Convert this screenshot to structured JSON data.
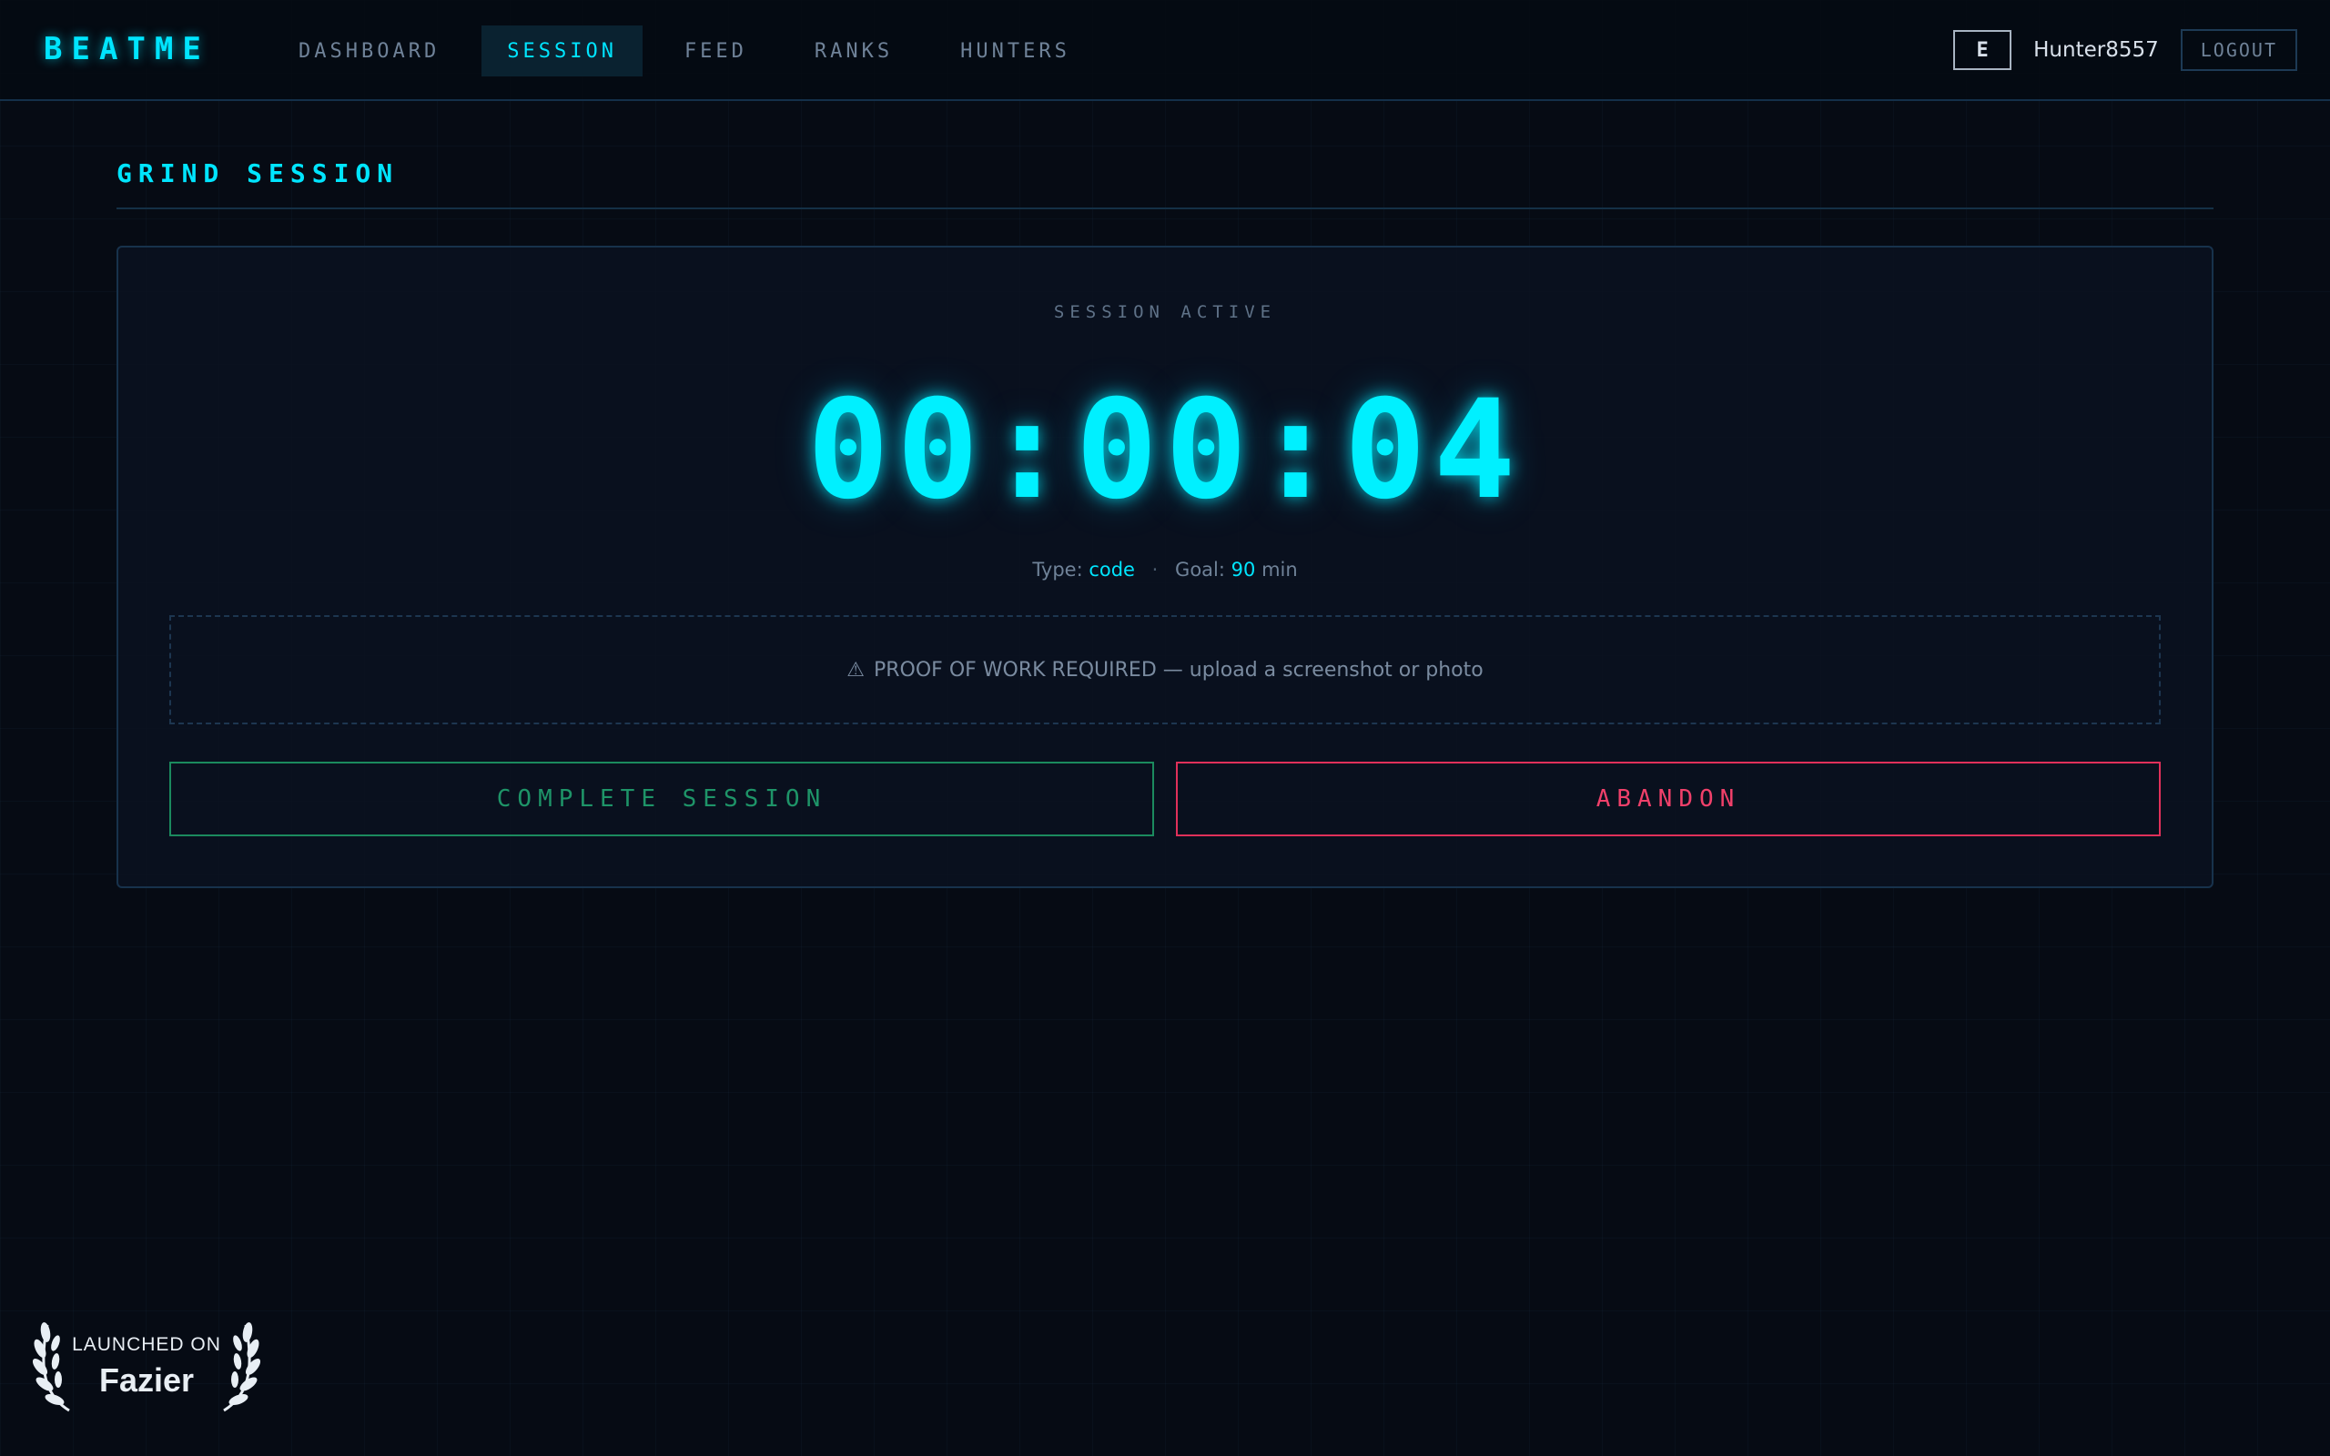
{
  "app": {
    "logo": "BEATME"
  },
  "nav": {
    "items": [
      {
        "label": "DASHBOARD"
      },
      {
        "label": "SESSION"
      },
      {
        "label": "FEED"
      },
      {
        "label": "RANKS"
      },
      {
        "label": "HUNTERS"
      }
    ],
    "active": "SESSION"
  },
  "user": {
    "rank": "E",
    "name": "Hunter8557",
    "logout_label": "LOGOUT"
  },
  "page": {
    "title": "GRIND SESSION"
  },
  "session": {
    "status": "SESSION ACTIVE",
    "timer": "00:00:04",
    "type_label": "Type:",
    "type_value": "code",
    "goal_label": "Goal:",
    "goal_value": "90",
    "goal_unit": "min",
    "separator": "·",
    "proof_icon": "⚠",
    "proof_text": "PROOF OF WORK REQUIRED — upload a screenshot or photo",
    "complete_label": "COMPLETE SESSION",
    "abandon_label": "ABANDON"
  },
  "badge": {
    "small": "LAUNCHED ON",
    "big": "Fazier"
  },
  "colors": {
    "accent": "#00e5ff",
    "success": "#1e9468",
    "danger": "#f0406a",
    "background": "#060b14"
  },
  "icons": {
    "proof": "warning-icon",
    "badge": "laurel-icon"
  }
}
